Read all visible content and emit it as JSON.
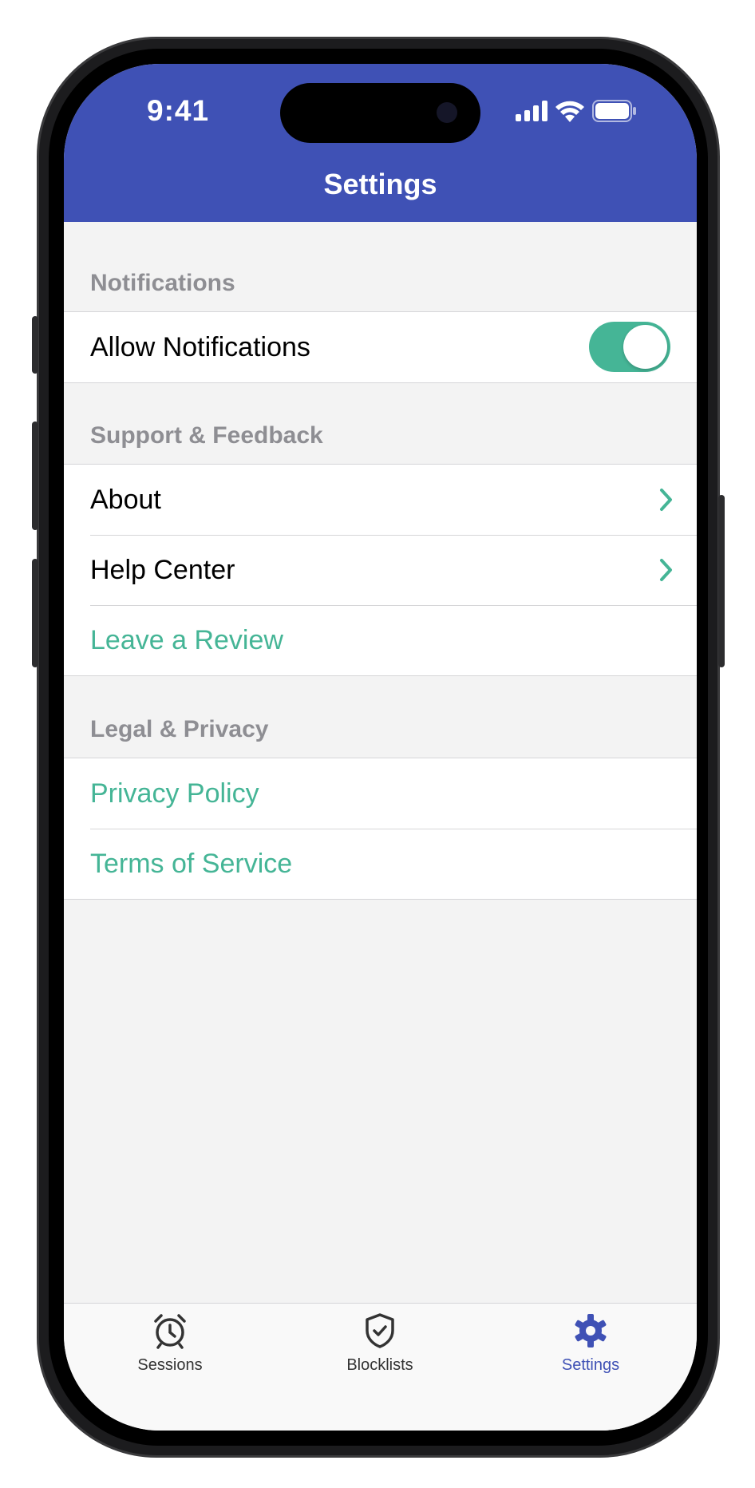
{
  "status_bar": {
    "time": "9:41"
  },
  "header": {
    "title": "Settings"
  },
  "sections": [
    {
      "label": "Notifications",
      "rows": [
        {
          "label": "Allow Notifications",
          "toggle_on": true
        }
      ]
    },
    {
      "label": "Support & Feedback",
      "rows": [
        {
          "label": "About"
        },
        {
          "label": "Help Center"
        },
        {
          "label": "Leave a Review"
        }
      ]
    },
    {
      "label": "Legal & Privacy",
      "rows": [
        {
          "label": "Privacy Policy"
        },
        {
          "label": "Terms of Service"
        }
      ]
    }
  ],
  "tabbar": {
    "tabs": [
      {
        "label": "Sessions",
        "icon": "alarm-clock-icon"
      },
      {
        "label": "Blocklists",
        "icon": "shield-check-icon"
      },
      {
        "label": "Settings",
        "icon": "gear-icon",
        "active": true
      }
    ]
  },
  "colors": {
    "header": "#3f51b5",
    "accent": "#45b596",
    "active_tab": "#3f51b5"
  }
}
